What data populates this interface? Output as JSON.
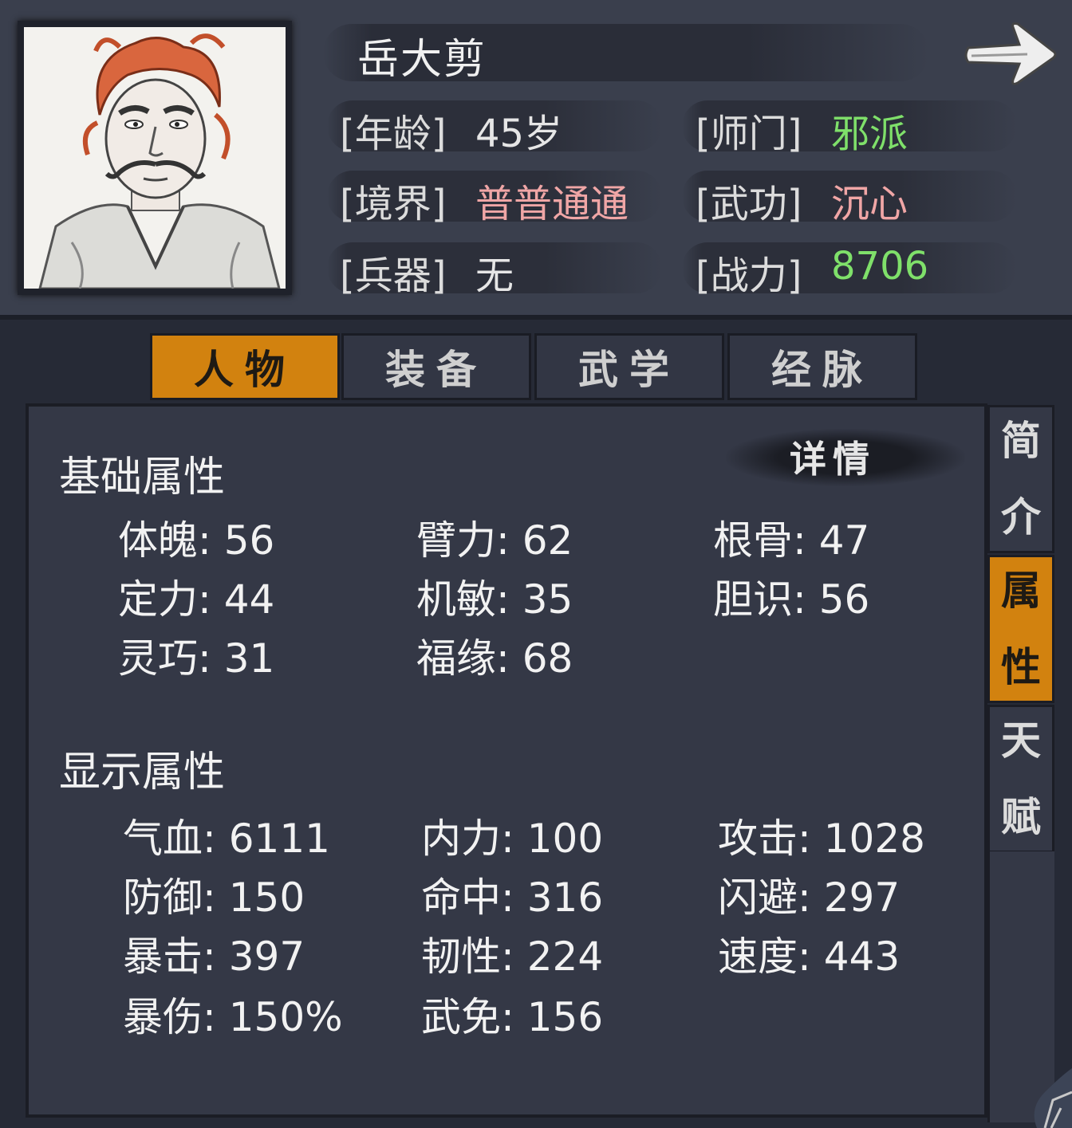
{
  "character": {
    "name": "岳大剪",
    "age_label": "[年龄]",
    "age_value": "45岁",
    "sect_label": "[师门]",
    "sect_value": "邪派",
    "realm_label": "[境界]",
    "realm_value": "普普通通",
    "skill_label": "[武功]",
    "skill_value": "沉心",
    "weapon_label": "[兵器]",
    "weapon_value": "无",
    "power_label": "[战力]",
    "power_value": "8706"
  },
  "colors": {
    "green": "#7fe06a",
    "pink": "#f0a6a6",
    "accent": "#d2820f"
  },
  "tabs": [
    {
      "label": "人物",
      "active": true
    },
    {
      "label": "装备",
      "active": false
    },
    {
      "label": "武学",
      "active": false
    },
    {
      "label": "经脉",
      "active": false
    }
  ],
  "side_tabs": [
    {
      "label_1": "简",
      "label_2": "介",
      "active": false
    },
    {
      "label_1": "属",
      "label_2": "性",
      "active": true
    },
    {
      "label_1": "天",
      "label_2": "赋",
      "active": false
    }
  ],
  "detail_button": "详情",
  "basic": {
    "title": "基础属性",
    "stats": [
      "体魄: 56",
      "臂力: 62",
      "根骨: 47",
      "定力: 44",
      "机敏: 35",
      "胆识: 56",
      "灵巧: 31",
      "福缘: 68"
    ]
  },
  "display": {
    "title": "显示属性",
    "stats": [
      "气血: 6111",
      "内力: 100",
      "攻击: 1028",
      "防御: 150",
      "命中: 316",
      "闪避: 297",
      "暴击: 397",
      "韧性: 224",
      "速度: 443",
      "暴伤: 150%",
      "武免: 156"
    ]
  },
  "icons": {
    "next": "arrow-right-icon",
    "portrait": "character-portrait"
  }
}
